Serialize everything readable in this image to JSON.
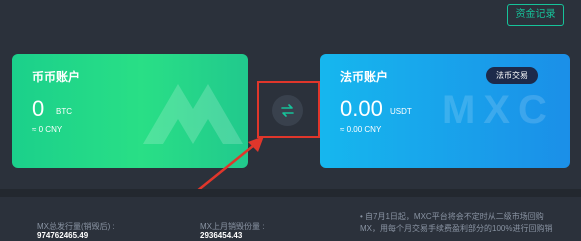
{
  "header": {
    "history_button": "资金记录"
  },
  "coin_account": {
    "title": "币币账户",
    "amount": "0",
    "unit": "BTC",
    "approx": "≈ 0 CNY"
  },
  "fiat_account": {
    "title": "法币账户",
    "amount": "0.00",
    "unit": "USDT",
    "approx": "≈ 0.00 CNY",
    "trade_button": "法币交易",
    "watermark": "MXC"
  },
  "stats": {
    "total_issue_label": "MX总发行量(销毁后) :",
    "total_issue_value": "974762465.49",
    "last_month_burn_label": "MX上月销毁份量 :",
    "last_month_burn_value": "2936454.43",
    "notice_line1": "• 自7月1日起，MXC平台将会不定时从二级市场回购",
    "notice_line2": "MX，用每个月交易手续费盈利部分的100%进行回购销"
  },
  "colors": {
    "accent": "#16c39a",
    "highlight": "#e0362b",
    "coin_card": "#1fd38b",
    "fiat_card": "#1a9eea"
  }
}
